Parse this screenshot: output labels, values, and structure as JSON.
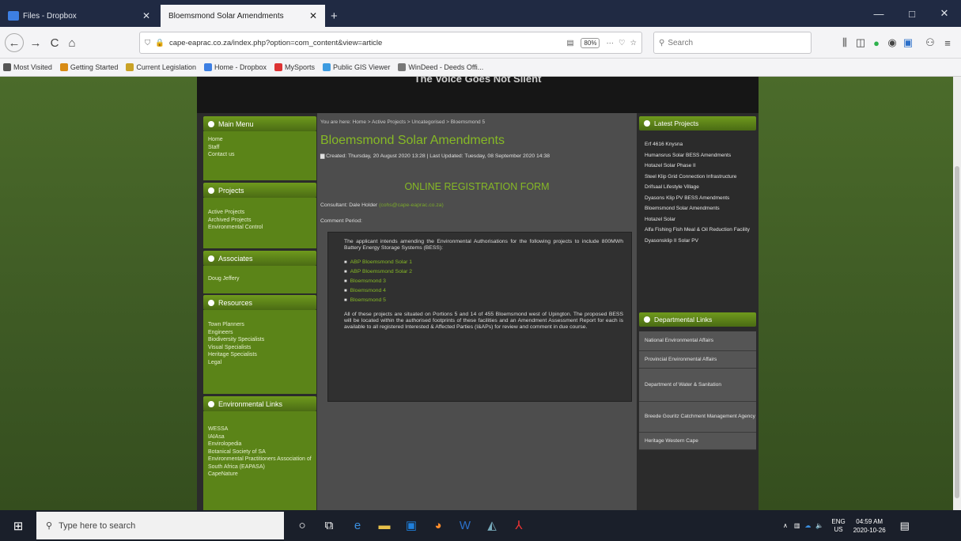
{
  "tabs": [
    {
      "title": "Files - Dropbox",
      "icon_color": "#3d7fe3"
    },
    {
      "title": "Bloemsmond Solar Amendments",
      "icon_color": "#7aa82a"
    }
  ],
  "window_controls": {
    "minimize": "—",
    "maximize": "□",
    "close": "✕"
  },
  "nav": {
    "back": "←",
    "forward": "→",
    "reload": "C",
    "home": "⌂",
    "url": "cape-eaprac.co.za/index.php?option=com_content&view=article",
    "zoom": "80%",
    "search_placeholder": "Search"
  },
  "bookmarks": [
    "Most Visited",
    "Getting Started",
    "Current Legislation",
    "Home - Dropbox",
    "MySports",
    "Public GIS Viewer",
    "WinDeed - Deeds Offi..."
  ],
  "bookmark_colors": [
    "#555",
    "#d88b15",
    "#c9a227",
    "#3d7fe3",
    "#d33",
    "#3d9be0",
    "#777"
  ],
  "site": {
    "header_text": "The Voice Goes Not Silent",
    "left_menu": [
      {
        "heading": "Main Menu",
        "items": [
          "Home",
          "Staff",
          "Contact us"
        ]
      },
      {
        "heading": "Projects",
        "items": [
          "Active Projects",
          "Archived Projects",
          "Environmental Control"
        ]
      },
      {
        "heading": "Associates",
        "items": [
          "Doug Jeffery"
        ]
      },
      {
        "heading": "Resources",
        "items": [
          "Town Planners",
          "Engineers",
          "Biodiversity Specialists",
          "Visual Specialists",
          "Heritage Specialists",
          "Legal"
        ]
      },
      {
        "heading": "Environmental Links",
        "items": [
          "WESSA",
          "IAIAsa",
          "Envirolopedia",
          "Botanical Society of SA",
          "Environmental Practitioners Association of South Africa (EAPASA)",
          "CapeNature"
        ]
      }
    ],
    "breadcrumb": "You are here: Home > Active Projects > Uncategorised > Bloemsmond 5",
    "title": "Bloemsmond Solar Amendments",
    "meta": "Created: Thursday, 20 August 2020 13:28 | Last Updated: Tuesday, 08 September 2020 14:38",
    "form_heading": "ONLINE REGISTRATION FORM",
    "consultant_label": "Consultant: Dale Holder",
    "consultant_email": "(cohs@cape-eaprac.co.za)",
    "comment_label": "Comment Period:",
    "comment_value": "",
    "intro": "The applicant intends amending the Environmental Authorisations for the following projects to include 800MWh Battery Energy Storage Systems (BESS):",
    "projects": [
      "ABP Bloemsmond Solar 1",
      "ABP Bloemsmond Solar 2",
      "Bloemsmond 3",
      "Bloemsmond 4",
      "Bloemsmond 5"
    ],
    "body": "All of these projects are situated on Portions 5 and 14 of 455 Bloemsmond west of Upington. The proposed BESS will be located within the authorised footprints of these facilities and an Amendment Assessment Report for each is available to all registered Interested & Affected Parties (I&APs) for review and comment in due course.",
    "latest_heading": "Latest Projects",
    "latest": [
      "Erf 4616 Knysna",
      "Humansrus Solar BESS Amendments",
      "Hotazel Solar Phase II",
      "Steel Klip Grid Connection Infrastructure",
      "Drifsaal Lifestyle Village",
      "Dyasons Klip PV BESS Amendments",
      "Bloemsmond Solar Amendments",
      "Hotazel Solar",
      "Alfa Fishing Fish Meal & Oil Reduction Facility",
      "Dyasonsklip II Solar PV"
    ],
    "dept_heading": "Departmental Links",
    "dept_links": [
      "National Environmental Affairs",
      "Provincial Environmental Affairs",
      "Department of Water & Sanitation",
      "Breede Gouritz Catchment Management Agency",
      "Heritage Western Cape"
    ]
  },
  "taskbar": {
    "search_placeholder": "Type here to search",
    "lang": "ENG",
    "region": "US",
    "time": "04:59 AM",
    "date": "2020-10-26"
  }
}
